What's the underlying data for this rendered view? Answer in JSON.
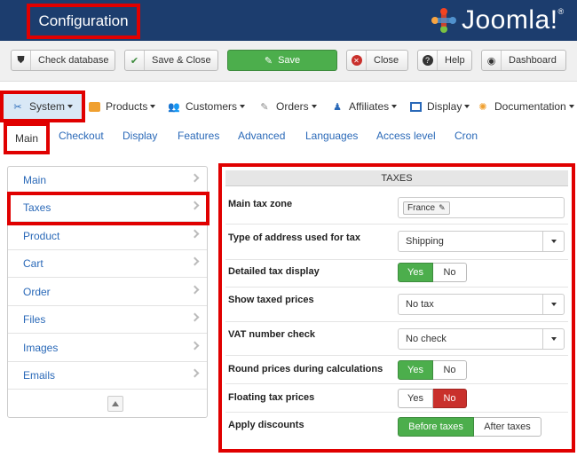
{
  "header": {
    "title": "Configuration",
    "logo_text": "Joomla!"
  },
  "toolbar": {
    "check_database": "Check database",
    "save_close": "Save & Close",
    "save": "Save",
    "close": "Close",
    "help": "Help",
    "dashboard": "Dashboard"
  },
  "menu": {
    "system": "System",
    "products": "Products",
    "customers": "Customers",
    "orders": "Orders",
    "affiliates": "Affiliates",
    "display": "Display",
    "documentation": "Documentation"
  },
  "subtabs": [
    "Main",
    "Checkout",
    "Display",
    "Features",
    "Advanced",
    "Languages",
    "Access level",
    "Cron"
  ],
  "sidebar": [
    "Main",
    "Taxes",
    "Product",
    "Cart",
    "Order",
    "Files",
    "Images",
    "Emails"
  ],
  "panel": {
    "heading": "TAXES",
    "main_tax_zone": {
      "label": "Main tax zone",
      "value": "France"
    },
    "address_type": {
      "label": "Type of address used for tax",
      "value": "Shipping"
    },
    "detailed_tax": {
      "label": "Detailed tax display",
      "yes": "Yes",
      "no": "No",
      "selected": "Yes"
    },
    "show_taxed": {
      "label": "Show taxed prices",
      "value": "No tax"
    },
    "vat_check": {
      "label": "VAT number check",
      "value": "No check"
    },
    "round_prices": {
      "label": "Round prices during calculations",
      "yes": "Yes",
      "no": "No",
      "selected": "Yes"
    },
    "floating_tax": {
      "label": "Floating tax prices",
      "yes": "Yes",
      "no": "No",
      "selected": "No"
    },
    "apply_discounts": {
      "label": "Apply discounts",
      "before": "Before taxes",
      "after": "After taxes",
      "selected": "Before taxes"
    }
  },
  "colors": {
    "header_bg": "#1c3d6e",
    "highlight": "#e00000",
    "green": "#4cae4c",
    "red": "#c9302c",
    "link": "#2a69b8"
  }
}
